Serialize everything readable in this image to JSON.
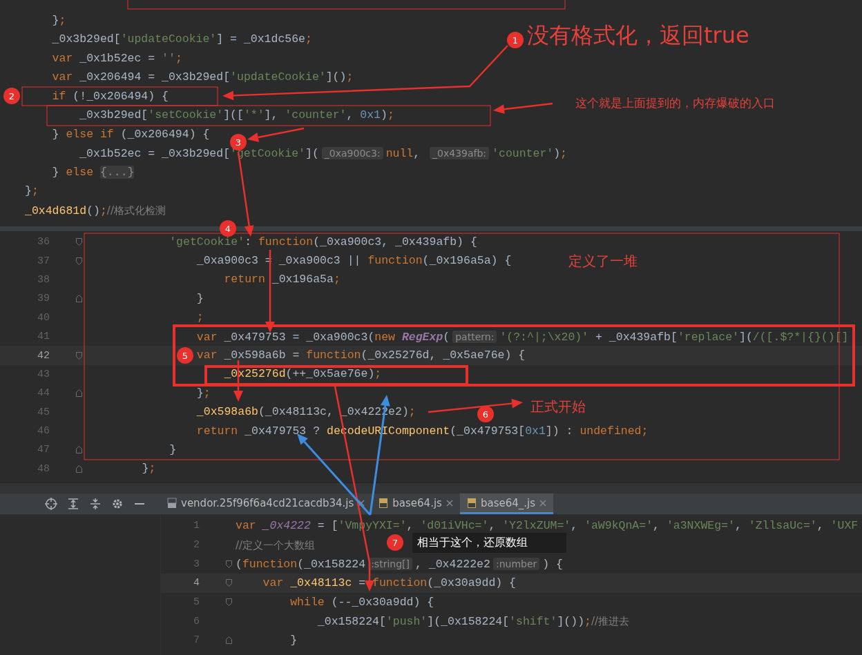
{
  "editor_top": {
    "lines": [
      {
        "tokens": [
          {
            "kind": "plain",
            "text": "    }"
          },
          {
            "kind": "kw",
            "text": ";"
          }
        ]
      },
      {
        "tokens": [
          {
            "kind": "plain",
            "text": "    _0x3b29ed["
          },
          {
            "kind": "str",
            "text": "'updateCookie'"
          },
          {
            "kind": "plain",
            "text": "] = _0x1dc56e"
          },
          {
            "kind": "kw",
            "text": ";"
          }
        ]
      },
      {
        "tokens": [
          {
            "kind": "kw",
            "text": "    var"
          },
          {
            "kind": "plain",
            "text": " _0x1b52ec = "
          },
          {
            "kind": "str",
            "text": "''"
          },
          {
            "kind": "kw",
            "text": ";"
          }
        ]
      },
      {
        "tokens": [
          {
            "kind": "kw",
            "text": "    var"
          },
          {
            "kind": "plain",
            "text": " _0x206494 = _0x3b29ed["
          },
          {
            "kind": "str",
            "text": "'updateCookie'"
          },
          {
            "kind": "plain",
            "text": "]()"
          },
          {
            "kind": "kw",
            "text": ";"
          }
        ]
      },
      {
        "tokens": [
          {
            "kind": "kw",
            "text": "    if"
          },
          {
            "kind": "plain",
            "text": " (!_0x206494) {"
          }
        ]
      },
      {
        "tokens": [
          {
            "kind": "plain",
            "text": "        _0x3b29ed["
          },
          {
            "kind": "str",
            "text": "'setCookie'"
          },
          {
            "kind": "plain",
            "text": "](["
          },
          {
            "kind": "str",
            "text": "'*'"
          },
          {
            "kind": "plain",
            "text": "], "
          },
          {
            "kind": "str",
            "text": "'counter'"
          },
          {
            "kind": "plain",
            "text": ", "
          },
          {
            "kind": "num",
            "text": "0x1"
          },
          {
            "kind": "plain",
            "text": ")"
          },
          {
            "kind": "kw",
            "text": ";"
          }
        ]
      },
      {
        "tokens": [
          {
            "kind": "plain",
            "text": "    } "
          },
          {
            "kind": "kw",
            "text": "else if"
          },
          {
            "kind": "plain",
            "text": " (_0x206494) {"
          }
        ]
      },
      {
        "tokens": [
          {
            "kind": "plain",
            "text": "        _0x1b52ec = _0x3b29ed["
          },
          {
            "kind": "str",
            "text": "'getCookie'"
          },
          {
            "kind": "plain",
            "text": "]("
          },
          {
            "kind": "hint",
            "text": "_0xa900c3:"
          },
          {
            "kind": "kw",
            "text": "null"
          },
          {
            "kind": "plain",
            "text": ", "
          },
          {
            "kind": "hint",
            "text": "_0x439afb:"
          },
          {
            "kind": "str",
            "text": "'counter'"
          },
          {
            "kind": "plain",
            "text": ")"
          },
          {
            "kind": "kw",
            "text": ";"
          }
        ]
      },
      {
        "tokens": [
          {
            "kind": "plain",
            "text": "    } "
          },
          {
            "kind": "kw",
            "text": "else "
          },
          {
            "kind": "fold",
            "text": "{...}"
          }
        ]
      },
      {
        "tokens": [
          {
            "kind": "plain",
            "text": "}"
          },
          {
            "kind": "kw",
            "text": ";"
          }
        ]
      },
      {
        "tokens": [
          {
            "kind": "fn",
            "text": "_0x4d681d"
          },
          {
            "kind": "plain",
            "text": "()"
          },
          {
            "kind": "kw",
            "text": ";"
          },
          {
            "kind": "cmt",
            "text": "//格式化检测"
          }
        ]
      }
    ]
  },
  "editor_middle": {
    "lines": [
      {
        "number": "36",
        "kind": "fold_start",
        "current": false,
        "tokens": [
          {
            "kind": "str",
            "text": "        'getCookie'"
          },
          {
            "kind": "plain",
            "text": ": "
          },
          {
            "kind": "kw",
            "text": "function"
          },
          {
            "kind": "plain",
            "text": "(_0xa900c3, _0x439afb) {"
          }
        ]
      },
      {
        "number": "37",
        "kind": "fold_start",
        "current": false,
        "tokens": [
          {
            "kind": "plain",
            "text": "            _0xa900c3 = _0xa900c3 || "
          },
          {
            "kind": "kw",
            "text": "function"
          },
          {
            "kind": "plain",
            "text": "(_0x196a5a) {"
          }
        ]
      },
      {
        "number": "38",
        "kind": "code",
        "current": false,
        "tokens": [
          {
            "kind": "kw",
            "text": "                return"
          },
          {
            "kind": "plain",
            "text": " _0x196a5a"
          },
          {
            "kind": "kw",
            "text": ";"
          }
        ]
      },
      {
        "number": "39",
        "kind": "fold_end",
        "current": false,
        "tokens": [
          {
            "kind": "plain",
            "text": "            }"
          }
        ]
      },
      {
        "number": "40",
        "kind": "code",
        "current": false,
        "tokens": [
          {
            "kind": "kw",
            "text": "            ;"
          }
        ]
      },
      {
        "number": "41",
        "kind": "code",
        "current": false,
        "tokens": [
          {
            "kind": "kw",
            "text": "            var"
          },
          {
            "kind": "plain",
            "text": " _0x479753 = _0xa900c3("
          },
          {
            "kind": "kw",
            "text": "new "
          },
          {
            "kind": "cls",
            "text": "RegExp"
          },
          {
            "kind": "plain",
            "text": "("
          },
          {
            "kind": "hint",
            "text": "pattern:"
          },
          {
            "kind": "str",
            "text": "'(?:^|;\\x20)'"
          },
          {
            "kind": "plain",
            "text": " + _0x439afb["
          },
          {
            "kind": "str",
            "text": "'replace'"
          },
          {
            "kind": "plain",
            "text": "]("
          },
          {
            "kind": "str",
            "text": "/([.$?*|{}()[]"
          }
        ]
      },
      {
        "number": "42",
        "kind": "fold_start",
        "current": true,
        "tokens": [
          {
            "kind": "kw",
            "text": "            var"
          },
          {
            "kind": "plain",
            "text": " _0x598a6b = "
          },
          {
            "kind": "kw",
            "text": "function"
          },
          {
            "kind": "plain",
            "text": "(_0x25276d, _0x5ae76e) {"
          }
        ]
      },
      {
        "number": "43",
        "kind": "code",
        "current": false,
        "tokens": [
          {
            "kind": "fn",
            "text": "                _0x25276d"
          },
          {
            "kind": "plain",
            "text": "(++_0x5ae76e)"
          },
          {
            "kind": "kw",
            "text": ";"
          }
        ]
      },
      {
        "number": "44",
        "kind": "fold_end",
        "current": false,
        "tokens": [
          {
            "kind": "plain",
            "text": "            }"
          },
          {
            "kind": "kw",
            "text": ";"
          }
        ]
      },
      {
        "number": "45",
        "kind": "code",
        "current": false,
        "tokens": [
          {
            "kind": "fn",
            "text": "            _0x598a6b"
          },
          {
            "kind": "plain",
            "text": "(_0x48113c, _0x4222e2)"
          },
          {
            "kind": "kw",
            "text": ";"
          }
        ]
      },
      {
        "number": "46",
        "kind": "code",
        "current": false,
        "tokens": [
          {
            "kind": "kw",
            "text": "            return"
          },
          {
            "kind": "plain",
            "text": " _0x479753 ? "
          },
          {
            "kind": "fn",
            "text": "decodeURIComponent"
          },
          {
            "kind": "plain",
            "text": "(_0x479753["
          },
          {
            "kind": "num",
            "text": "0x1"
          },
          {
            "kind": "plain",
            "text": "]) : "
          },
          {
            "kind": "kw",
            "text": "undefined"
          },
          {
            "kind": "kw",
            "text": ";"
          }
        ]
      },
      {
        "number": "47",
        "kind": "fold_end",
        "current": false,
        "tokens": [
          {
            "kind": "plain",
            "text": "        }"
          }
        ]
      },
      {
        "number": "48",
        "kind": "fold_end",
        "current": false,
        "tokens": [
          {
            "kind": "plain",
            "text": "    }"
          },
          {
            "kind": "kw",
            "text": ";"
          }
        ]
      }
    ]
  },
  "tabs": [
    {
      "label": "vendor.25f96f6a4cd21cacdb34.js",
      "selected": false
    },
    {
      "label": "base64.js",
      "selected": false
    },
    {
      "label": "base64_.js",
      "selected": true
    }
  ],
  "editor_bottom": {
    "lines": [
      {
        "number": "1",
        "kind": "code",
        "current": false,
        "tokens": [
          {
            "kind": "kw",
            "text": "var "
          },
          {
            "kind": "glob",
            "text": "_0x4222"
          },
          {
            "kind": "plain",
            "text": " = ["
          },
          {
            "kind": "str",
            "text": "'VmpyYXI='"
          },
          {
            "kind": "plain",
            "text": ", "
          },
          {
            "kind": "str",
            "text": "'d01iVHc='"
          },
          {
            "kind": "plain",
            "text": ", "
          },
          {
            "kind": "str",
            "text": "'Y2lxZUM='"
          },
          {
            "kind": "plain",
            "text": ", "
          },
          {
            "kind": "str",
            "text": "'aW9kQnA='"
          },
          {
            "kind": "plain",
            "text": ", "
          },
          {
            "kind": "str",
            "text": "'a3NXWEg='"
          },
          {
            "kind": "plain",
            "text": ", "
          },
          {
            "kind": "str",
            "text": "'ZllsaUc='"
          },
          {
            "kind": "plain",
            "text": ", "
          },
          {
            "kind": "str",
            "text": "'UXF"
          }
        ]
      },
      {
        "number": "2",
        "kind": "code",
        "current": false,
        "tokens": [
          {
            "kind": "cmt",
            "text": "//定义一个大数组"
          }
        ]
      },
      {
        "number": "3",
        "kind": "fold_start",
        "current": false,
        "tokens": [
          {
            "kind": "plain",
            "text": "("
          },
          {
            "kind": "kw",
            "text": "function"
          },
          {
            "kind": "plain",
            "text": "(_0x158224"
          },
          {
            "kind": "hint",
            "text": ":string[]"
          },
          {
            "kind": "plain",
            "text": ", _0x4222e2"
          },
          {
            "kind": "hint",
            "text": ":number"
          },
          {
            "kind": "plain",
            "text": ") {"
          }
        ]
      },
      {
        "number": "4",
        "kind": "fold_start",
        "current": true,
        "tokens": [
          {
            "kind": "kw",
            "text": "    var "
          },
          {
            "kind": "fn",
            "text": "_0x48113c"
          },
          {
            "kind": "plain",
            "text": " = "
          },
          {
            "kind": "kw",
            "text": "function"
          },
          {
            "kind": "plain",
            "text": "(_0x30a9dd) {"
          }
        ]
      },
      {
        "number": "5",
        "kind": "fold_start",
        "current": false,
        "tokens": [
          {
            "kind": "kw",
            "text": "        while"
          },
          {
            "kind": "plain",
            "text": " (--_0x30a9dd) {"
          }
        ]
      },
      {
        "number": "6",
        "kind": "code",
        "current": false,
        "tokens": [
          {
            "kind": "plain",
            "text": "            _0x158224["
          },
          {
            "kind": "str",
            "text": "'push'"
          },
          {
            "kind": "plain",
            "text": "](_0x158224["
          },
          {
            "kind": "str",
            "text": "'shift'"
          },
          {
            "kind": "plain",
            "text": "]())"
          },
          {
            "kind": "kw",
            "text": ";"
          },
          {
            "kind": "cmt",
            "text": "//推进去"
          }
        ]
      },
      {
        "number": "7",
        "kind": "fold_end",
        "current": false,
        "tokens": [
          {
            "kind": "plain",
            "text": "        }"
          }
        ]
      }
    ]
  },
  "annotations": {
    "markers": [
      "1",
      "2",
      "3",
      "4",
      "5",
      "6",
      "7"
    ],
    "notes": [
      "没有格式化，返回true",
      "这个就是上面提到的，内存爆破的入口",
      "定义了一堆",
      "正式开始"
    ],
    "tooltip": "相当于这个，还原数组"
  }
}
